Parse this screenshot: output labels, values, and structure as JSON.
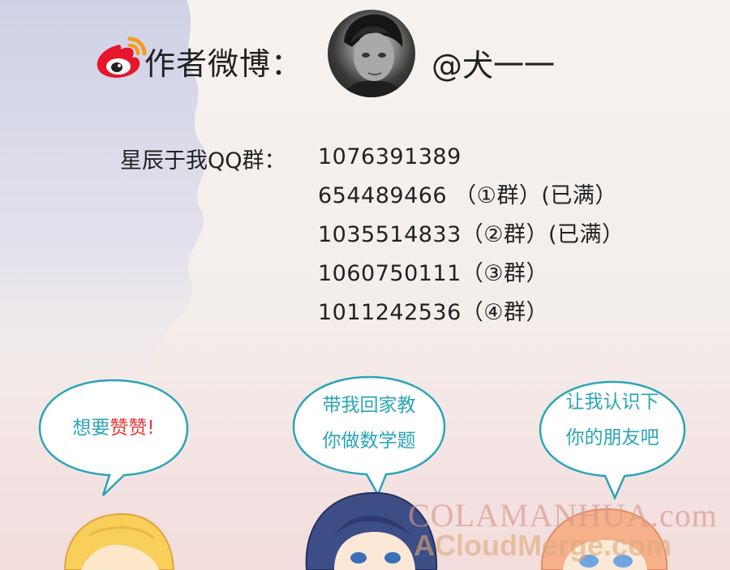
{
  "weibo": {
    "label": "作者微博：",
    "handle": "@犬一一"
  },
  "qq": {
    "label": "星辰于我QQ群：",
    "groups": [
      "1076391389",
      "654489466 （①群）(已满）",
      "1035514833（②群）(已满）",
      "1060750111（③群）",
      "1011242536（④群）"
    ]
  },
  "bubbles": [
    {
      "line1_prefix": "想要",
      "line1_emphasis": "赞赞",
      "line1_suffix": "!"
    },
    {
      "line1": "带我回家教",
      "line2": "你做数学题"
    },
    {
      "line1": "让我认识下",
      "line2": "你的朋友吧"
    }
  ],
  "watermark": {
    "line1": "COLAMANHUA.com",
    "line2": "ACloudMerge.com"
  },
  "colors": {
    "bubble_text": "#2aa4b7",
    "bubble_border": "#2aa4b7",
    "emphasis": "#e8383d",
    "weibo_red": "#e6162d",
    "weibo_orange": "#f59c1a"
  },
  "icons": [
    "weibo-logo-icon",
    "author-avatar"
  ]
}
